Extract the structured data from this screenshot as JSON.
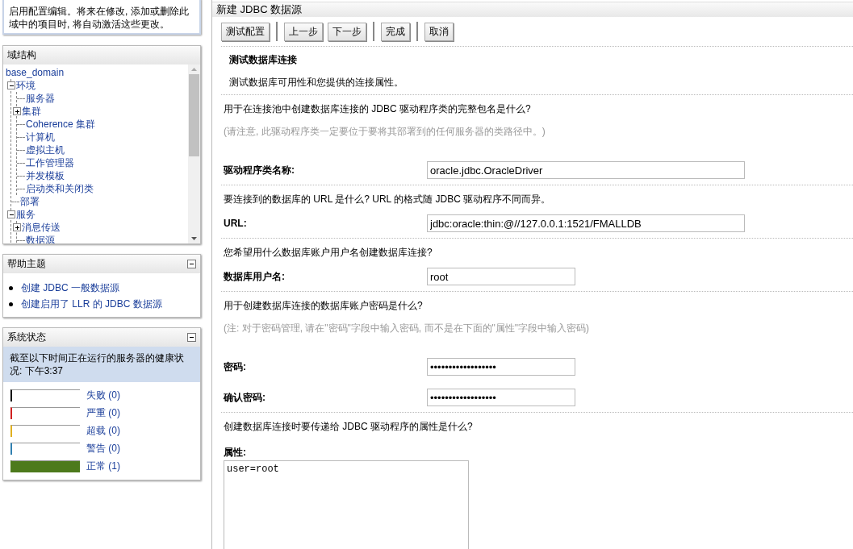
{
  "notice": {
    "text": "启用配置编辑。将来在修改, 添加或删除此域中的项目时, 将自动激活这些更改。"
  },
  "domain_structure": {
    "title": "域结构",
    "tree": [
      {
        "label": "base_domain",
        "children": [
          {
            "label": "环境",
            "expanded": true,
            "children": [
              {
                "label": "服务器"
              },
              {
                "label": "集群",
                "expanded": false
              },
              {
                "label": "Coherence 集群"
              },
              {
                "label": "计算机"
              },
              {
                "label": "虚拟主机"
              },
              {
                "label": "工作管理器"
              },
              {
                "label": "并发模板"
              },
              {
                "label": "启动类和关闭类"
              }
            ]
          },
          {
            "label": "部署"
          },
          {
            "label": "服务",
            "expanded": true,
            "children": [
              {
                "label": "消息传送",
                "expanded": false
              },
              {
                "label": "数据源"
              }
            ]
          }
        ]
      }
    ]
  },
  "help_topics": {
    "title": "帮助主题",
    "links": [
      "创建 JDBC 一般数据源",
      "创建启用了 LLR 的 JDBC 数据源"
    ]
  },
  "system_status": {
    "title": "系统状态",
    "summary": "截至以下时间正在运行的服务器的健康状况:  下午3:37",
    "health": [
      {
        "label": "失败 (0)",
        "level": 0,
        "color": "#000000"
      },
      {
        "label": "严重 (0)",
        "level": 0,
        "color": "#d02020"
      },
      {
        "label": "超载 (0)",
        "level": 0,
        "color": "#e0b020"
      },
      {
        "label": "警告 (0)",
        "level": 0,
        "color": "#3080b0"
      },
      {
        "label": "正常 (1)",
        "level": 1,
        "color": "#4d7a1c"
      }
    ]
  },
  "main": {
    "title": "新建 JDBC 数据源",
    "button_groups": [
      [
        "测试配置"
      ],
      [
        "上一步",
        "下一步"
      ],
      [
        "完成"
      ],
      [
        "取消"
      ]
    ],
    "section_title": "测试数据库连接",
    "section_desc": "测试数据库可用性和您提供的连接属性。",
    "blocks": [
      {
        "question": "用于在连接池中创建数据库连接的 JDBC 驱动程序类的完整包名是什么?",
        "note": "(请注意, 此驱动程序类一定要位于要将其部署到的任何服务器的类路径中。)",
        "fields": [
          {
            "kind": "wide",
            "label": "驱动程序类名称:",
            "value": "oracle.jdbc.OracleDriver"
          }
        ]
      },
      {
        "question": "要连接到的数据库的 URL 是什么? URL 的格式随 JDBC 驱动程序不同而异。",
        "fields": [
          {
            "kind": "wide",
            "label": "URL:",
            "value": "jdbc:oracle:thin:@//127.0.0.1:1521/FMALLDB"
          }
        ]
      },
      {
        "question": "您希望用什么数据库账户用户名创建数据库连接?",
        "fields": [
          {
            "kind": "short",
            "label": "数据库用户名:",
            "value": "root"
          }
        ]
      },
      {
        "question": "用于创建数据库连接的数据库账户密码是什么?",
        "note": "(注: 对于密码管理, 请在\"密码\"字段中输入密码, 而不是在下面的\"属性\"字段中输入密码)",
        "fields": [
          {
            "kind": "short",
            "label": "密码:",
            "value": "••••••••••••••••••"
          },
          {
            "kind": "short",
            "label": "确认密码:",
            "value": "••••••••••••••••••"
          }
        ]
      },
      {
        "question": "创建数据库连接时要传递给 JDBC 驱动程序的属性是什么?",
        "fields": [
          {
            "kind": "area",
            "label": "属性:",
            "value": "user=root"
          }
        ]
      }
    ]
  }
}
